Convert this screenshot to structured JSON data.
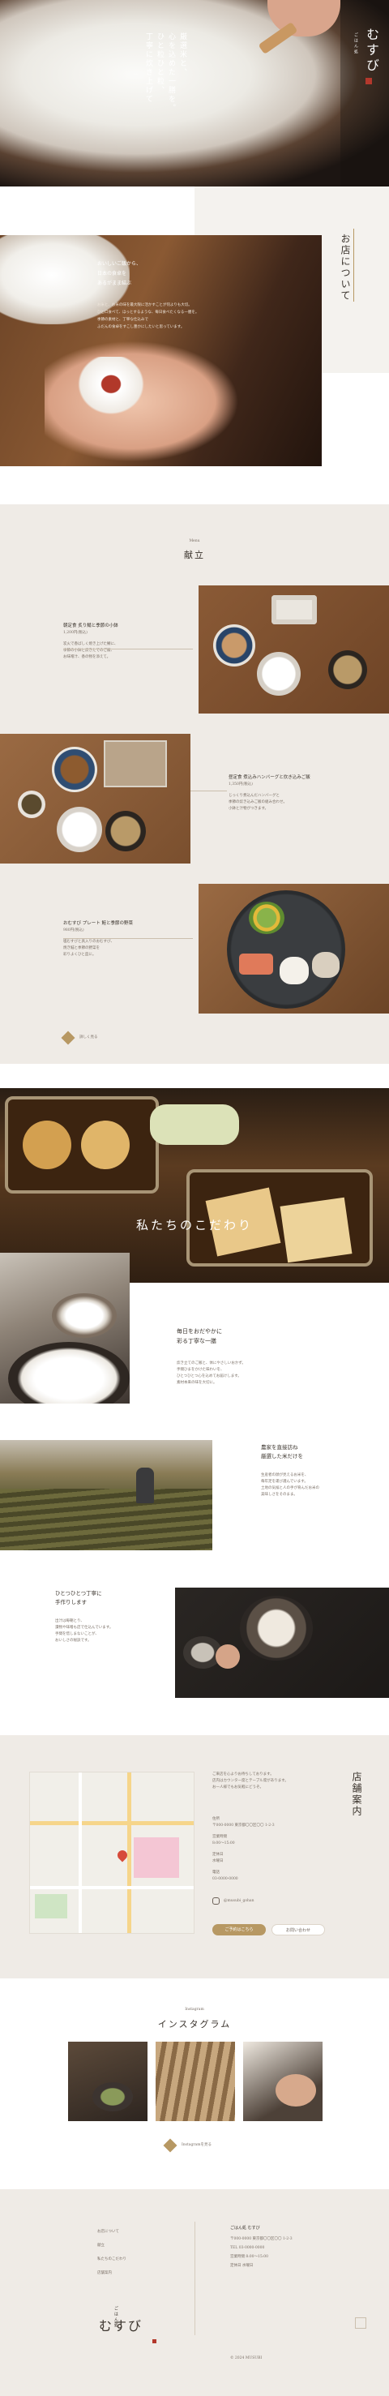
{
  "brand": {
    "name": "むすび",
    "prefix": "ごはん処"
  },
  "hero": {
    "copy_lines": [
      "厳選米と、",
      "心を込めた一膳を。",
      "ひと粒ひと粒、",
      "丁寧に炊き上げて"
    ],
    "scroll_label": "SCROLL"
  },
  "about": {
    "heading": "お店について",
    "lead": [
      "おいしいご飯から、",
      "日本の食卓を",
      "あるがまま結ぶ"
    ],
    "body": [
      "お米と、お米の味を最大限に活かすことが何よりも大切。",
      "ひと口食べて、ほっとするような、毎日食べたくなる一膳を。",
      "季節の素材と、丁寧な仕込みで",
      "ふだんの食卓をすこし豊かにしたいと思っています。"
    ]
  },
  "menu": {
    "label_small": "Menu",
    "heading": "献立",
    "items": [
      {
        "title": "朝定食 炙り鯖と季節の小鉢",
        "price": "1,200円(税込)",
        "desc": [
          "炭火で香ばしく焼き上げた鯖に、",
          "季節の小鉢と炊きたてのご飯、",
          "お味噌汁、香の物を添えて。"
        ]
      },
      {
        "title": "昼定食 煮込みハンバーグと炊き込みご飯",
        "price": "1,350円(税込)",
        "desc": [
          "じっくり煮込んだハンバーグと",
          "季節の炊き込みご飯の組み合わせ。",
          "小鉢と汁物がつきます。"
        ]
      },
      {
        "title": "おむすび プレート 鮭と季節の野菜",
        "price": "980円(税込)",
        "desc": [
          "塩むすびと具入りのおむすび、",
          "焼き鮭と季節の野菜を",
          "彩りよくひと皿に。"
        ]
      }
    ],
    "more_link": "詳しく見る"
  },
  "kodawari": {
    "heading": "私たちのこだわり",
    "blocks": [
      {
        "title": [
          "毎日をおだやかに",
          "彩る丁寧な一膳"
        ],
        "body": [
          "炊き立てのご飯と、体にやさしいおかず。",
          "手間ひまをかけた味わいを、",
          "ひとつひとつ心を込めてお届けします。",
          "素材本来の味を大切に。"
        ]
      },
      {
        "title": [
          "農家を直接訪ね",
          "厳選した米だけを"
        ],
        "body": [
          "生産者の顔が見えるお米を、",
          "毎年足を運び選んでいます。",
          "土地の気候と人の手が育んだお米の",
          "美味しさをそのまま。"
        ]
      },
      {
        "title": [
          "ひとつひとつ丁寧に",
          "手作りします"
        ],
        "body": [
          "出汁は毎朝とり、",
          "漬物や味噌も店で仕込んでいます。",
          "手間を惜しまないことが、",
          "おいしさの秘訣です。"
        ]
      }
    ]
  },
  "shop": {
    "heading": "店舗案内",
    "intro": [
      "ご来店を心よりお待ちしております。",
      "店内はカウンター席とテーブル席があります。",
      "お一人様でもお気軽にどうぞ。"
    ],
    "fields": [
      {
        "label": "住所",
        "value": "〒000-0000 東京都〇〇区〇〇 1-2-3"
      },
      {
        "label": "営業時間",
        "value": "8:00〜15:00"
      },
      {
        "label": "定休日",
        "value": "水曜日"
      },
      {
        "label": "電話",
        "value": "03-0000-0000"
      }
    ],
    "instagram_handle": "@musubi_gohan",
    "btn_reserve": "ご予約はこちら",
    "btn_contact": "お問い合わせ"
  },
  "instagram": {
    "label_small": "Instagram",
    "heading": "インスタグラム",
    "more": "Instagramを見る"
  },
  "footer": {
    "nav": [
      "お店について",
      "献立",
      "私たちのこだわり",
      "店舗案内"
    ],
    "company": "ごはん処 むすび",
    "info": [
      "〒000-0000 東京都〇〇区〇〇 1-2-3",
      "TEL 03-0000-0000",
      "営業時間 8:00〜15:00",
      "定休日 水曜日"
    ],
    "copyright": "© 2024 MUSUBI"
  }
}
